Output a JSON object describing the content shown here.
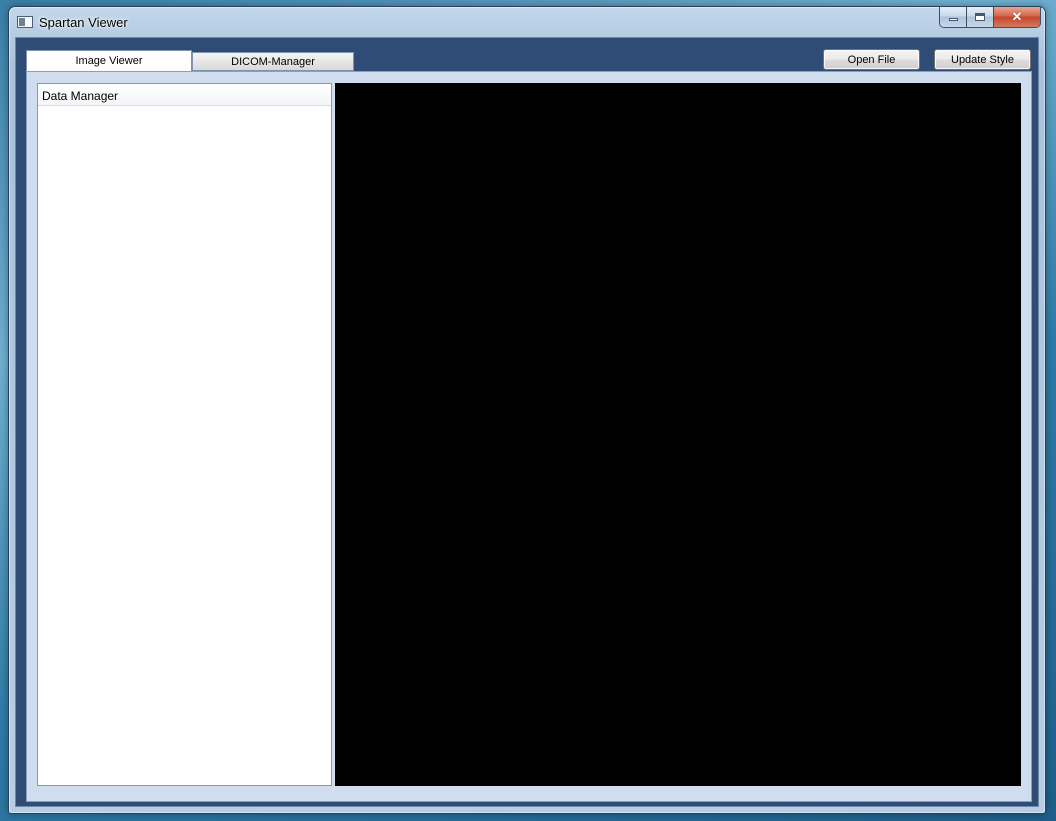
{
  "window": {
    "title": "Spartan Viewer",
    "icon": "app-window-icon",
    "caption": {
      "minimize_icon": "minimize-icon",
      "maximize_icon": "maximize-icon",
      "close_glyph": "✕"
    }
  },
  "tabs": [
    {
      "label": "Image Viewer",
      "selected": true
    },
    {
      "label": "DICOM-Manager",
      "selected": false
    }
  ],
  "toolbar": {
    "open_label": "Open File",
    "update_label": "Update Style"
  },
  "data_manager": {
    "header": "Data Manager",
    "items": []
  },
  "viewer": {
    "background": "#000000"
  },
  "colors": {
    "window_frame": "#b4cbe2",
    "client_bg": "#2e4c75",
    "panel_bg": "#cfddef",
    "close_button": "#c3462a"
  }
}
